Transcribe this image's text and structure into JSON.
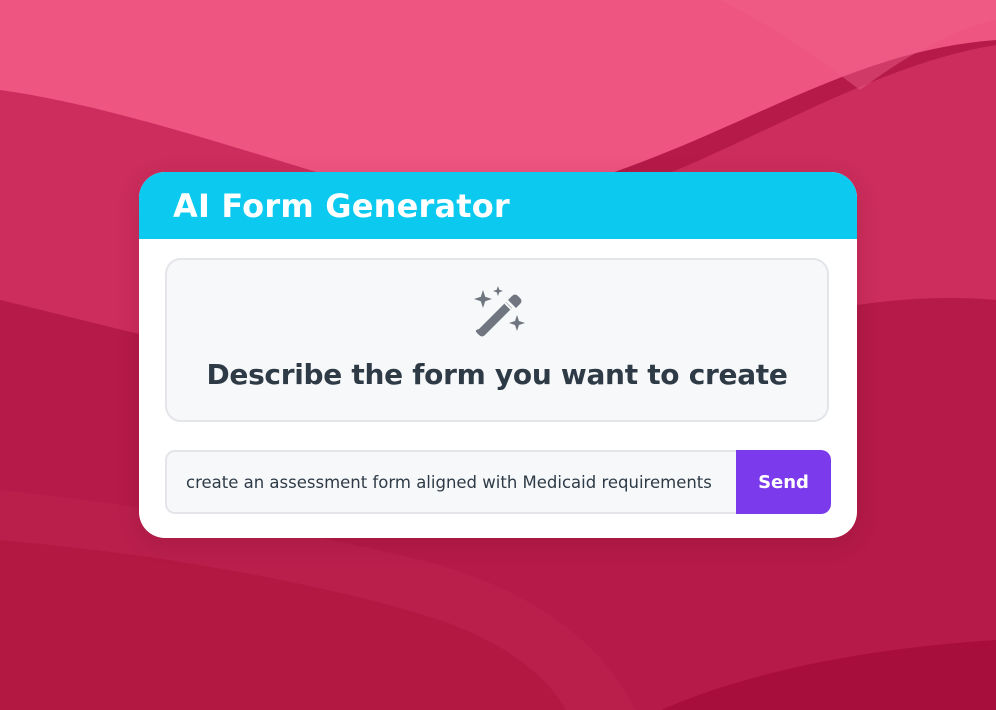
{
  "header": {
    "title": "AI Form Generator"
  },
  "prompt": {
    "icon": "magic-wand-sparkles-icon",
    "text": "Describe the form you want to create"
  },
  "input": {
    "value": "create an assessment form aligned with Medicaid requirements",
    "placeholder": ""
  },
  "send": {
    "label": "Send"
  },
  "colors": {
    "header": "#0cc9ef",
    "send_button": "#7c3aed",
    "background_light": "#ee5580",
    "background_dark": "#a80e3b",
    "prompt_text": "#2e3b47",
    "icon": "#6f7680"
  }
}
